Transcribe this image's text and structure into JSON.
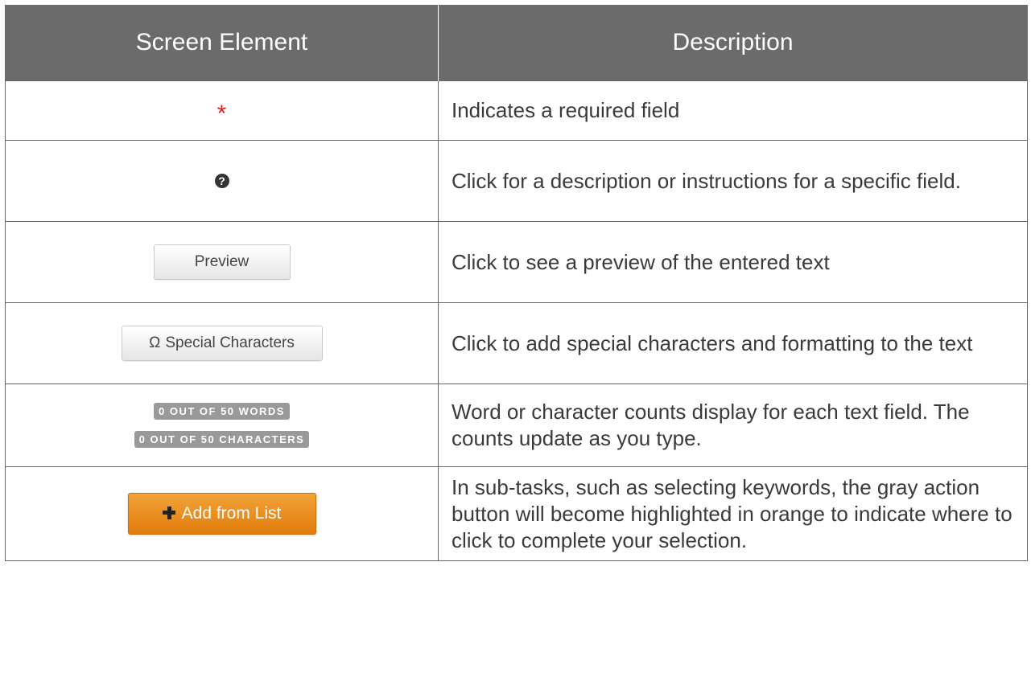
{
  "header": {
    "col_element": "Screen Element",
    "col_description": "Description"
  },
  "rows": [
    {
      "element": {
        "type": "asterisk",
        "glyph": "*",
        "color": "#e02020"
      },
      "description": "Indicates a required field"
    },
    {
      "element": {
        "type": "help-icon",
        "glyph": "?"
      },
      "description": "Click for a description or instructions for a specific field."
    },
    {
      "element": {
        "type": "button",
        "label": "Preview"
      },
      "description": "Click to see a preview of the entered text"
    },
    {
      "element": {
        "type": "button",
        "icon": "Ω",
        "label": "Special Characters"
      },
      "description": "Click to add special characters and formatting to the text"
    },
    {
      "element": {
        "type": "badges",
        "badges": [
          "0 OUT OF 50 WORDS",
          "0 OUT OF 50 CHARACTERS"
        ]
      },
      "description": "Word or character counts display for each text field.  The counts update as you type."
    },
    {
      "element": {
        "type": "orange-button",
        "icon": "plus-icon",
        "label": "Add from List",
        "color": "#e8901f"
      },
      "description": "In sub-tasks, such as selecting keywords, the gray action button will become highlighted in orange to indicate where to click to complete your selection."
    }
  ],
  "colors": {
    "header_bg": "#6b6b6b",
    "header_text": "#ffffff",
    "border": "#666666",
    "badge_bg": "#999999",
    "required": "#e02020"
  }
}
